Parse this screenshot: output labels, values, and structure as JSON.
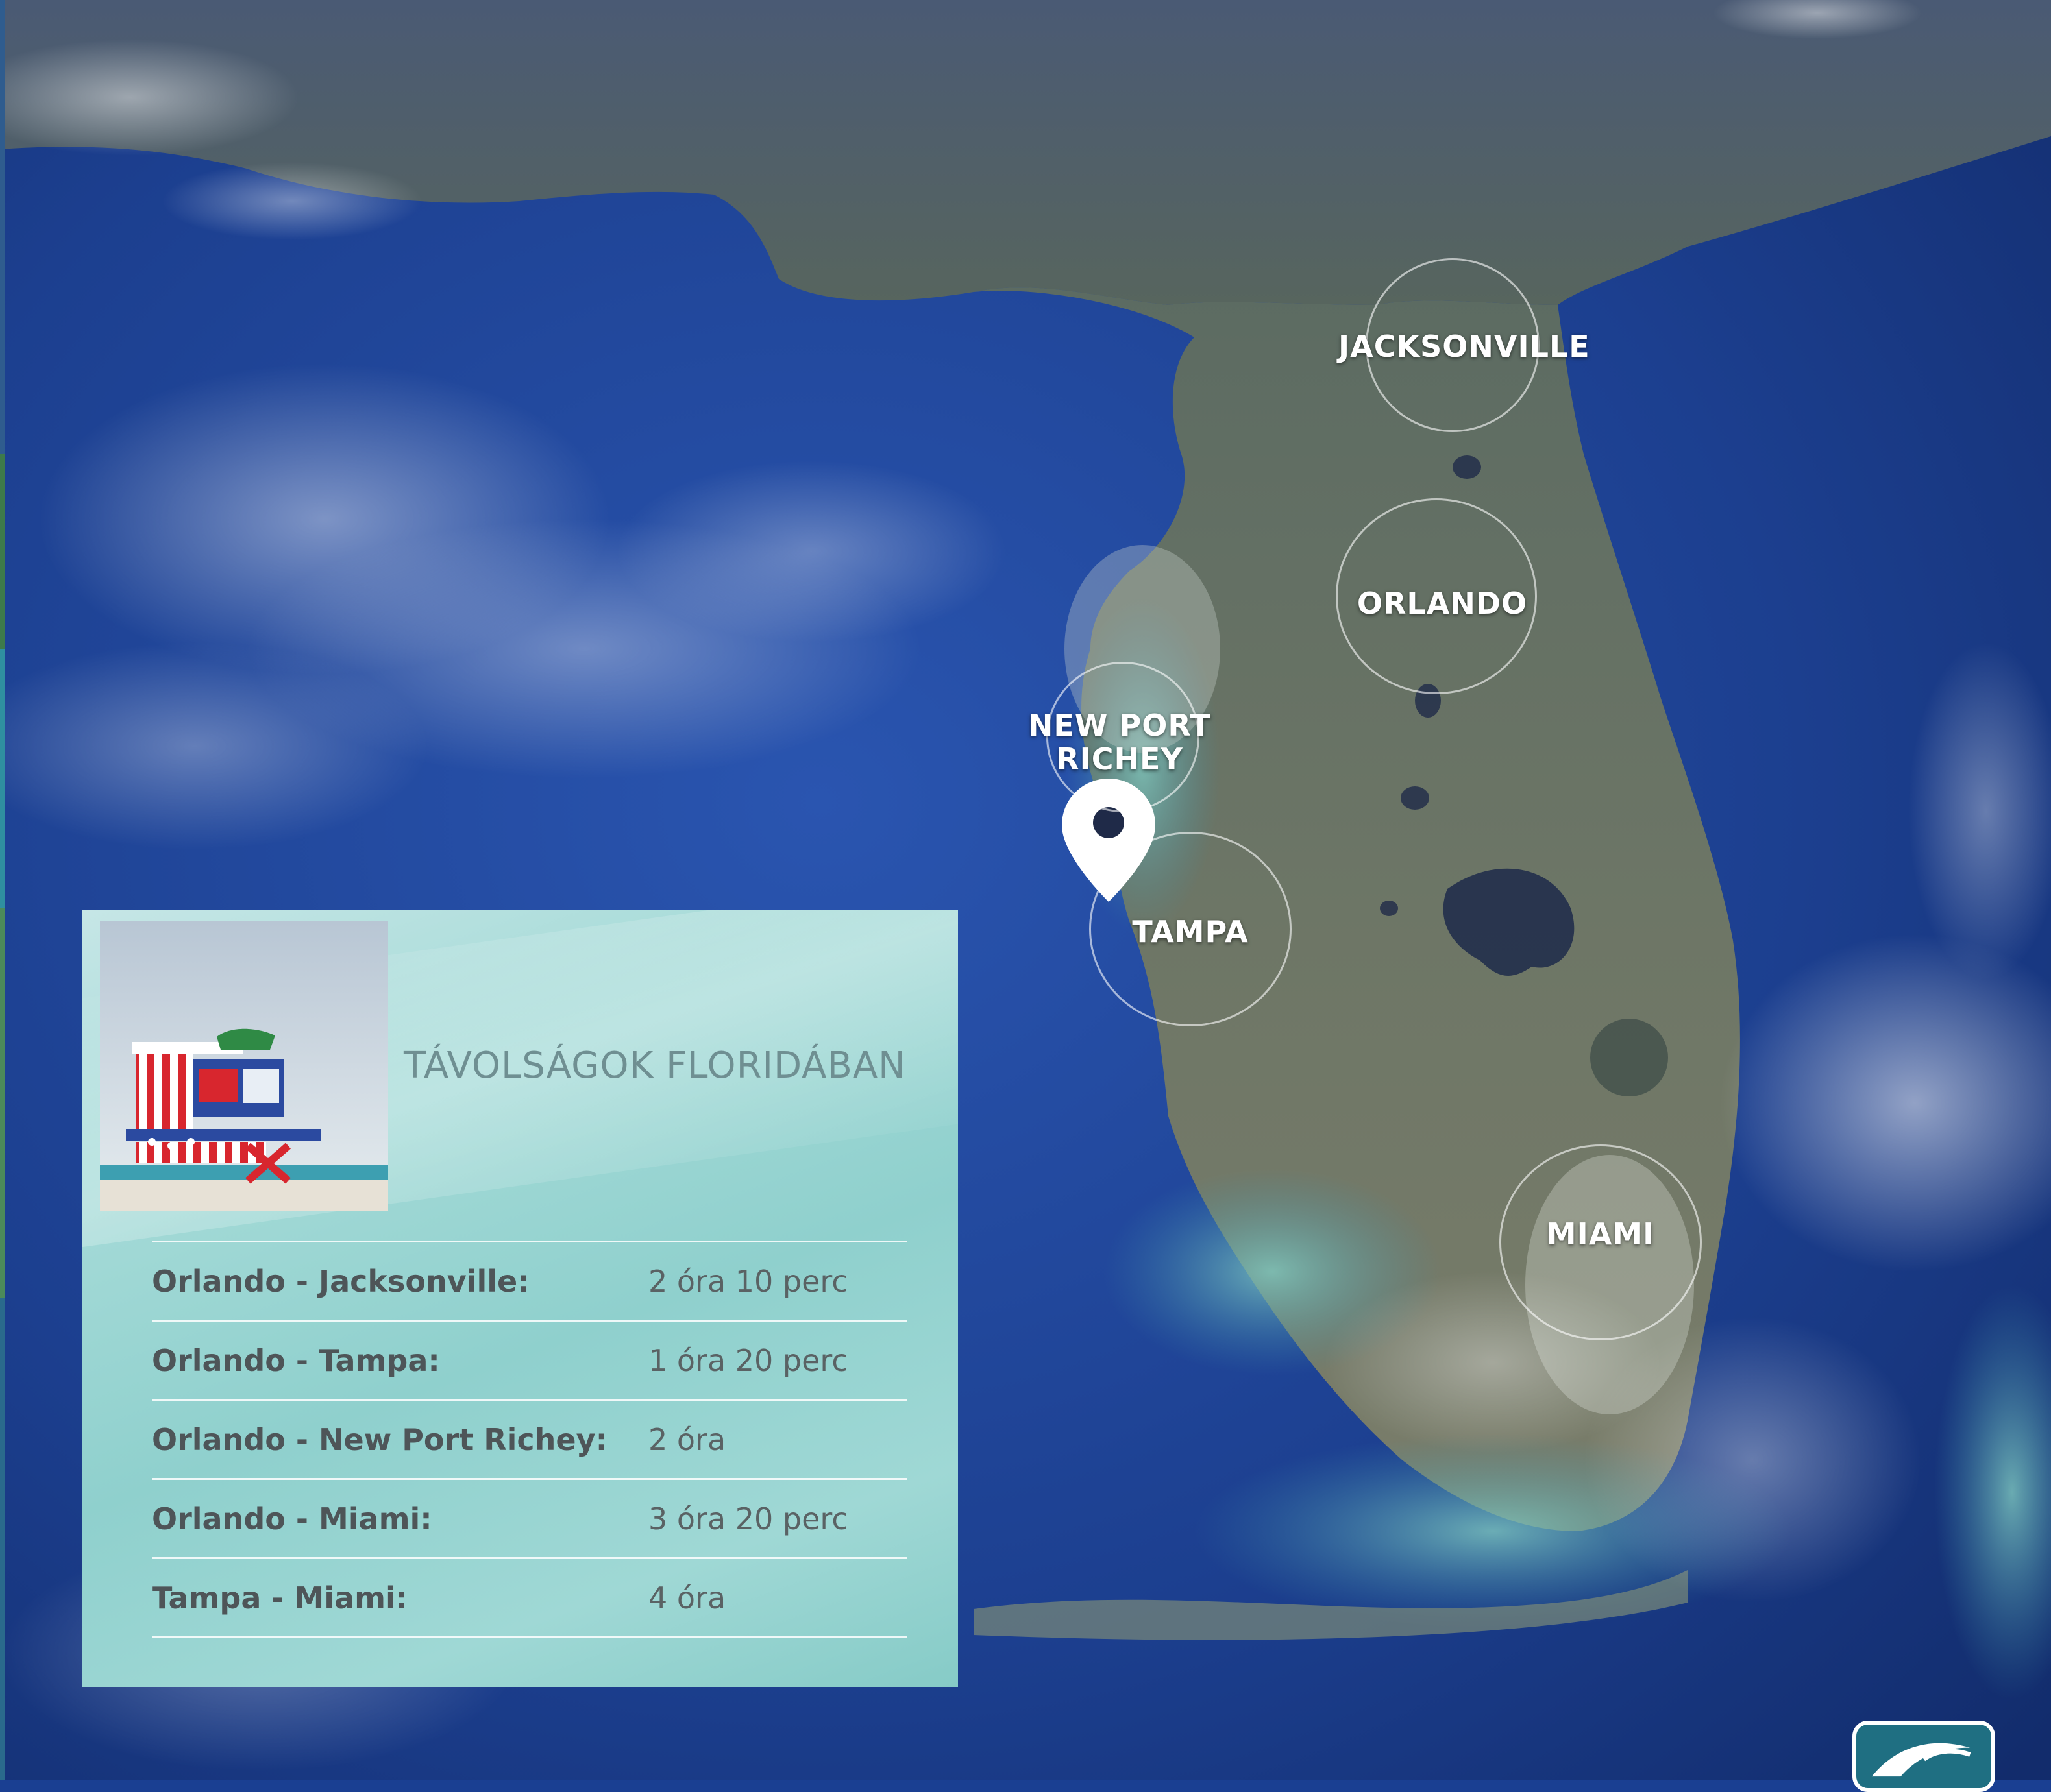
{
  "map": {
    "pin_icon": "map-pin-icon",
    "cities": [
      {
        "key": "jacksonville",
        "label": "JACKSONVILLE"
      },
      {
        "key": "orlando",
        "label": "ORLANDO"
      },
      {
        "key": "new_port_richey",
        "label": "NEW PORT\nRICHEY"
      },
      {
        "key": "tampa",
        "label": "TAMPA"
      },
      {
        "key": "miami",
        "label": "MIAMI"
      }
    ]
  },
  "panel": {
    "title": "TÁVOLSÁGOK FLORIDÁBAN",
    "photo": "lifeguard-tower-photo",
    "rows": [
      {
        "route": "Orlando - Jacksonville:",
        "time": "2 óra 10 perc"
      },
      {
        "route": "Orlando - Tampa:",
        "time": "1 óra 20 perc"
      },
      {
        "route": "Orlando - New Port Richey:",
        "time": "2 óra"
      },
      {
        "route": "Orlando - Miami:",
        "time": "3 óra 20 perc"
      },
      {
        "route": "Tampa - Miami:",
        "time": "4 óra"
      }
    ]
  },
  "colors": {
    "ocean": "#1a3f92",
    "land": "#6f7a67",
    "panel_teal": "#9fd8d5",
    "title_grey": "#6f8f92",
    "route_text": "#4e5558"
  },
  "logo": "brand-logo-icon"
}
